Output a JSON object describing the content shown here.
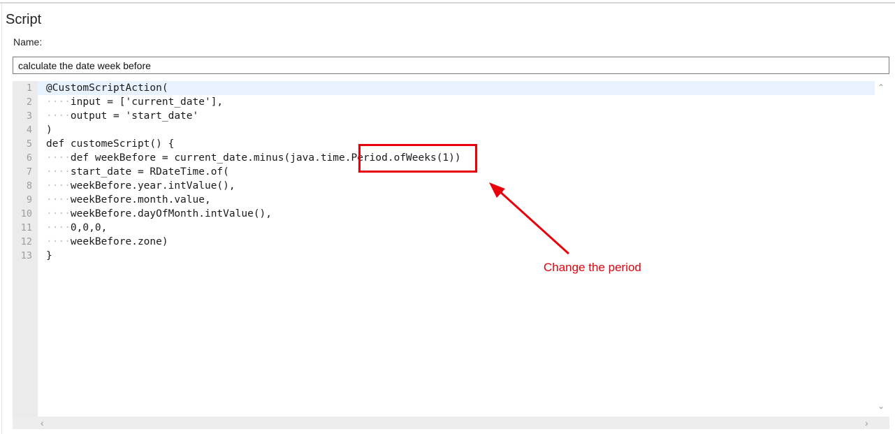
{
  "panel": {
    "title": "Script",
    "name_label": "Name:",
    "name_value": "calculate the date week before"
  },
  "editor": {
    "line_numbers": [
      "1",
      "2",
      "3",
      "4",
      "5",
      "6",
      "7",
      "8",
      "9",
      "10",
      "11",
      "12",
      "13"
    ],
    "lines": [
      "@CustomScriptAction(",
      "····input = ['current_date'],",
      "····output = 'start_date'",
      ")",
      "def customeScript() {",
      "····def weekBefore = current_date.minus(java.time.Period.ofWeeks(1))",
      "····start_date = RDateTime.of(",
      "····weekBefore.year.intValue(),",
      "····weekBefore.month.value,",
      "····weekBefore.dayOfMonth.intValue(),",
      "····0,0,0,",
      "····weekBefore.zone)",
      "}"
    ]
  },
  "scrollbar": {
    "up_icon": "chevron-up-icon",
    "down_icon": "chevron-down-icon",
    "left_icon": "chevron-left-icon",
    "right_icon": "chevron-right-icon"
  },
  "annotation": {
    "text": "Change the period",
    "color": "#e8000b"
  }
}
